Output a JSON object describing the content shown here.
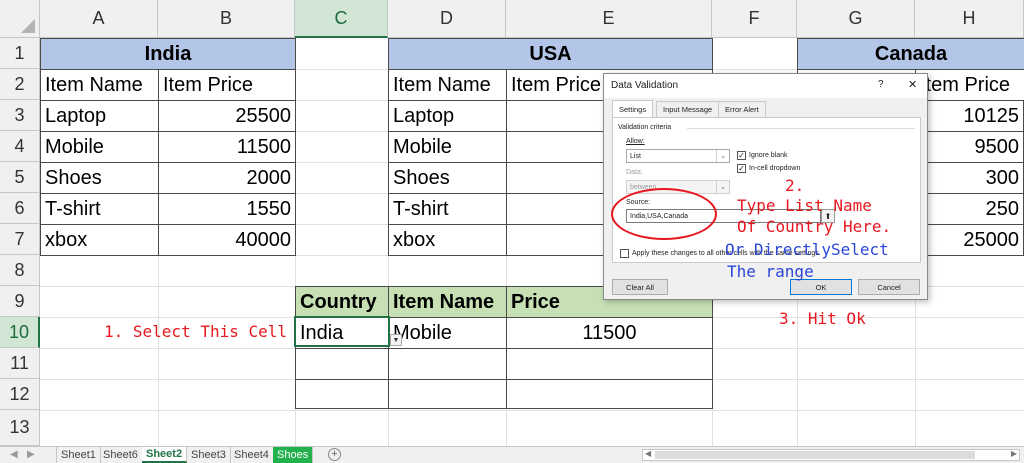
{
  "columns": [
    "A",
    "B",
    "C",
    "D",
    "E",
    "F",
    "G",
    "H"
  ],
  "rows": [
    "1",
    "2",
    "3",
    "4",
    "5",
    "6",
    "7",
    "8",
    "9",
    "10",
    "11",
    "12",
    "13"
  ],
  "selected_column": "C",
  "selected_row": "10",
  "tables": {
    "india": {
      "title": "India",
      "headers": [
        "Item Name",
        "Item Price"
      ],
      "rows": [
        [
          "Laptop",
          "25500"
        ],
        [
          "Mobile",
          "11500"
        ],
        [
          "Shoes",
          "2000"
        ],
        [
          "T-shirt",
          "1550"
        ],
        [
          "xbox",
          "40000"
        ]
      ]
    },
    "usa": {
      "title": "USA",
      "headers": [
        "Item Name",
        "Item Price"
      ],
      "items": [
        "Laptop",
        "Mobile",
        "Shoes",
        "T-shirt",
        "xbox"
      ]
    },
    "canada": {
      "title": "Canada",
      "header_fragment": "Item Price",
      "prices": [
        "10125",
        "9500",
        "300",
        "250",
        "25000"
      ]
    },
    "lookup": {
      "headers": [
        "Country",
        "Item Name",
        "Price"
      ],
      "row": [
        "India",
        "Mobile",
        "11500"
      ]
    }
  },
  "annotations": {
    "step1": "1.  Select This Cell",
    "step2_num": "2.",
    "step2_l1": "Type List Name",
    "step2_l2": "Of Country Here.",
    "step2_l3": "Or DirectlySelect",
    "step2_l4": "The range",
    "step3": "3. Hit Ok"
  },
  "dialog": {
    "title": "Data Validation",
    "help": "?",
    "close": "✕",
    "tabs": [
      "Settings",
      "Input Message",
      "Error Alert"
    ],
    "criteria_label": "Validation criteria",
    "allow_label": "Allow:",
    "allow_value": "List",
    "ignore_blank": "Ignore blank",
    "in_cell_dropdown": "In-cell dropdown",
    "data_label": "Data:",
    "data_value": "between",
    "source_label": "Source:",
    "source_value": "India,USA,Canada",
    "apply_all": "Apply these changes to all other cells with the same settings",
    "clear_all": "Clear All",
    "ok": "OK",
    "cancel": "Cancel"
  },
  "sheet_tabs": [
    "Sheet1",
    "Sheet6",
    "Sheet2",
    "Sheet3",
    "Sheet4",
    "Shoes"
  ],
  "active_tab": "Sheet2",
  "colors": {
    "title_fill": "#b4c6e7",
    "lookup_header_fill": "#c6e0b4",
    "annotation_red": "#e8171f",
    "annotation_blue": "#2b46d8",
    "accent": "#217346"
  }
}
